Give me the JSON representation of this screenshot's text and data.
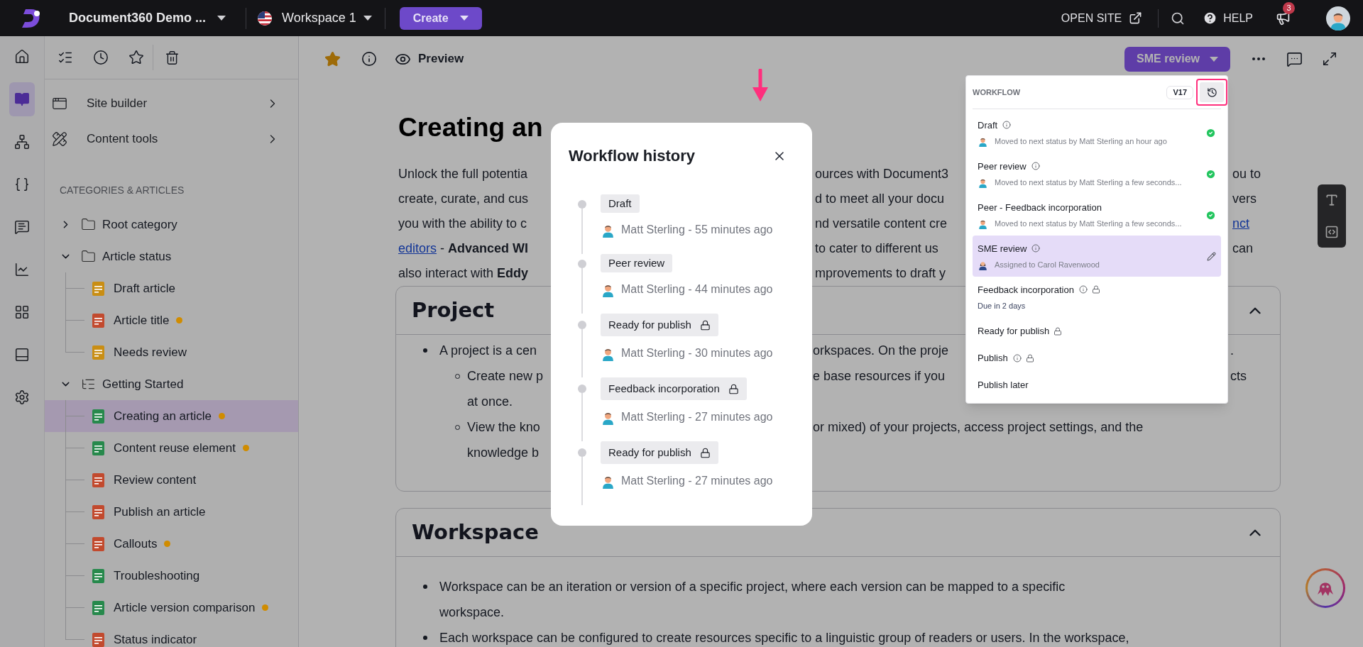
{
  "topbar": {
    "project": "Document360 Demo ...",
    "workspace": "Workspace 1",
    "create": "Create",
    "open_site": "OPEN SITE",
    "help": "HELP",
    "notifications": "3"
  },
  "rail": [
    {
      "kind": "home",
      "selected": false
    },
    {
      "kind": "book",
      "selected": true
    },
    {
      "kind": "diagram",
      "selected": false
    },
    {
      "kind": "braces",
      "selected": false
    },
    {
      "kind": "message",
      "selected": false
    },
    {
      "kind": "chart",
      "selected": false
    },
    {
      "kind": "apps",
      "selected": false
    },
    {
      "kind": "panel",
      "selected": false
    },
    {
      "kind": "settings",
      "selected": false
    }
  ],
  "sidebar": {
    "menu": [
      {
        "kind": "site",
        "label": "Site builder"
      },
      {
        "kind": "tools",
        "label": "Content tools"
      }
    ],
    "section_title": "CATEGORIES & ARTICLES",
    "tree": [
      {
        "kind": "folder",
        "label": "Root category",
        "expanded": false,
        "selected": false
      },
      {
        "kind": "folder",
        "label": "Article status",
        "expanded": true,
        "selected": false,
        "children": [
          {
            "kind": "article",
            "label": "Draft article",
            "color": "#c98e14",
            "unsaved": false,
            "selected": false
          },
          {
            "kind": "article",
            "label": "Article title",
            "color": "#c24a2e",
            "unsaved": true,
            "selected": false
          },
          {
            "kind": "article",
            "label": "Needs review",
            "color": "#c98e14",
            "unsaved": false,
            "selected": false
          }
        ]
      },
      {
        "kind": "category",
        "label": "Getting Started",
        "expanded": true,
        "selected": false,
        "children": [
          {
            "kind": "article",
            "label": "Creating an article",
            "color": "#27894c",
            "unsaved": true,
            "selected": true
          },
          {
            "kind": "article",
            "label": "Content reuse element",
            "color": "#27894c",
            "unsaved": true,
            "selected": false
          },
          {
            "kind": "article",
            "label": "Review content",
            "color": "#c24a2e",
            "unsaved": false,
            "selected": false
          },
          {
            "kind": "article",
            "label": "Publish an article",
            "color": "#c24a2e",
            "unsaved": false,
            "selected": false
          },
          {
            "kind": "article",
            "label": "Callouts",
            "color": "#c24a2e",
            "unsaved": true,
            "selected": false
          },
          {
            "kind": "article",
            "label": "Troubleshooting",
            "color": "#27894c",
            "unsaved": false,
            "selected": false
          },
          {
            "kind": "article",
            "label": "Article version comparison",
            "color": "#27894c",
            "unsaved": true,
            "selected": false
          },
          {
            "kind": "article",
            "label": "Status indicator",
            "color": "#c24a2e",
            "unsaved": false,
            "selected": false
          }
        ]
      }
    ]
  },
  "article": {
    "starred": true,
    "preview": "Preview",
    "status": "SME review",
    "title": "Creating an",
    "intro": [
      {
        "left": [
          "Unlock the full potentia"
        ],
        "middle": [
          "ources with Document3"
        ],
        "right": [
          "ou to"
        ]
      },
      {
        "left": [
          "create, curate, and cus"
        ],
        "middle": [
          "d to meet all your docu"
        ],
        "right": [
          "vers"
        ]
      },
      {
        "left": [
          "you with the ability to c"
        ],
        "middle": [
          "nd versatile content cre"
        ],
        "right": [
          {
            "link": "nct"
          }
        ]
      },
      {
        "left": [
          {
            "link": "editors"
          },
          " - **Advanced WI**"
        ],
        "middle": [
          "to cater to different us"
        ],
        "right": [
          "can"
        ]
      },
      {
        "left": [
          "also interact with **Eddy**"
        ],
        "middle": [
          "mprovements to draft y"
        ]
      }
    ],
    "sections": [
      {
        "title": "Project",
        "expanded": true,
        "items": [
          {
            "lines": [
              {
                "left": [
                  "A project is a cen"
                ],
                "middle": [
                  "orkspaces. On the proje"
                ],
                "right": [
                  "."
                ]
              }
            ],
            "children": [
              {
                "lines": [
                  {
                    "left": [
                      "Create new p"
                    ],
                    "middle": [
                      "e base resources if you"
                    ],
                    "right": [
                      "cts"
                    ]
                  },
                  {
                    "left": [
                      "at once."
                    ]
                  }
                ]
              },
              {
                "lines": [
                  {
                    "left": [
                      "View the kno"
                    ],
                    "middle": [
                      "or mixed) of your projects, access project settings, and the"
                    ]
                  },
                  {
                    "left": [
                      "knowledge b"
                    ]
                  }
                ]
              }
            ]
          }
        ]
      },
      {
        "title": "Workspace",
        "expanded": true,
        "items": [
          {
            "lines": [
              {
                "left": [
                  "Workspace can be an iteration or version of a specific project, where each version can be mapped to a specific"
                ]
              },
              {
                "left": [
                  "workspace."
                ]
              }
            ]
          },
          {
            "lines": [
              {
                "left": [
                  "Each workspace can be configured to create resources specific to a linguistic group of readers or users. In the workspace,"
                ]
              }
            ]
          }
        ]
      }
    ]
  },
  "workflow_history": {
    "title": "Workflow history",
    "entries": [
      {
        "status": "Draft",
        "locked": false,
        "byline": "Matt Sterling - 55 minutes ago"
      },
      {
        "status": "Peer review",
        "locked": false,
        "byline": "Matt Sterling - 44 minutes ago"
      },
      {
        "status": "Ready for publish",
        "locked": true,
        "byline": "Matt Sterling - 30 minutes ago"
      },
      {
        "status": "Feedback incorporation",
        "locked": true,
        "byline": "Matt Sterling - 27 minutes ago"
      },
      {
        "status": "Ready for publish",
        "locked": true,
        "byline": "Matt Sterling - 27 minutes ago"
      }
    ]
  },
  "workflow_menu": {
    "title": "WORKFLOW",
    "version": "V17",
    "steps": [
      {
        "label": "Draft",
        "info": true,
        "locked": false,
        "done": true,
        "selected": false,
        "avatar": {
          "kind": "male"
        },
        "detail": "Moved to next status by Matt Sterling an hour ago"
      },
      {
        "label": "Peer review",
        "info": true,
        "locked": false,
        "done": true,
        "selected": false,
        "avatar": {
          "kind": "male"
        },
        "detail": "Moved to next status by Matt Sterling a few seconds..."
      },
      {
        "label": "Peer - Feedback incorporation",
        "info": false,
        "locked": false,
        "done": true,
        "selected": false,
        "avatar": {
          "kind": "male"
        },
        "detail": "Moved to next status by Matt Sterling a few seconds..."
      },
      {
        "label": "SME review",
        "info": true,
        "locked": false,
        "done": false,
        "selected": true,
        "avatar": {
          "kind": "female"
        },
        "detail": "Assigned to Carol Ravenwood"
      },
      {
        "label": "Feedback incorporation",
        "info": true,
        "locked": true,
        "done": false,
        "selected": false,
        "detail": "Due in 2 days"
      },
      {
        "label": "Ready for publish",
        "info": false,
        "locked": true,
        "done": false,
        "selected": false
      },
      {
        "label": "Publish",
        "info": true,
        "locked": true,
        "done": false,
        "selected": false
      },
      {
        "label": "Publish later",
        "info": false,
        "locked": false,
        "done": false,
        "selected": false
      }
    ]
  }
}
